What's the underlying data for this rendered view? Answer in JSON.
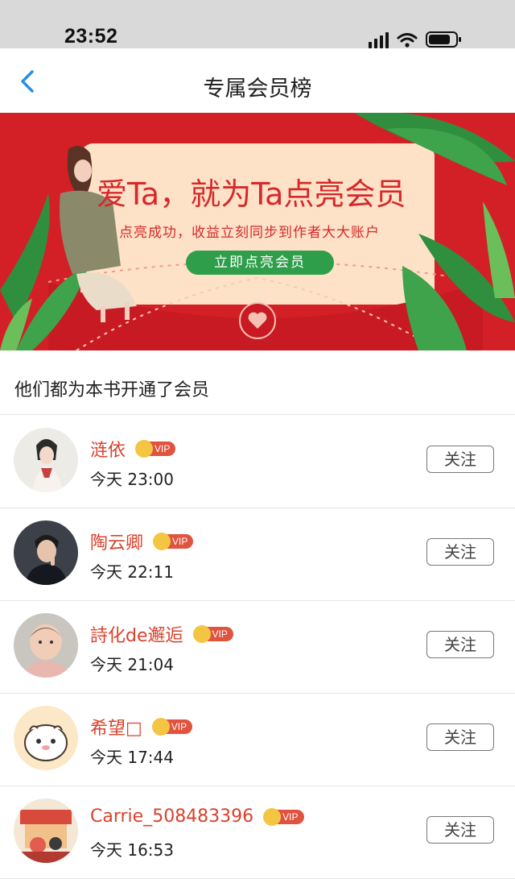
{
  "status": {
    "time": "23:52"
  },
  "nav": {
    "title": "专属会员榜"
  },
  "banner": {
    "headline": "爱Ta，就为Ta点亮会员",
    "subtitle": "点亮成功，收益立刻同步到作者大大账户",
    "cta": "立即点亮会员"
  },
  "section": {
    "title": "他们都为本书开通了会员"
  },
  "vip_label": "VIP",
  "members": [
    {
      "name": "涟依",
      "time": "今天 23:00",
      "follow": "关注",
      "avatar": "portrait-painting-avatar"
    },
    {
      "name": "陶云卿",
      "time": "今天 22:11",
      "follow": "关注",
      "avatar": "man-photo-avatar"
    },
    {
      "name": "詩化de邂逅",
      "time": "今天 21:04",
      "follow": "关注",
      "avatar": "baby-photo-avatar"
    },
    {
      "name": "希望□",
      "time": "今天 17:44",
      "follow": "关注",
      "avatar": "cartoon-avatar"
    },
    {
      "name": "Carrie_508483396",
      "time": "今天 16:53",
      "follow": "关注",
      "avatar": "cartoon-shop-avatar"
    }
  ],
  "colors": {
    "accent_name": "#d9422c",
    "banner_red": "#d7282a",
    "cta_green": "#2e9e4a",
    "back_blue": "#2a8fe0"
  }
}
